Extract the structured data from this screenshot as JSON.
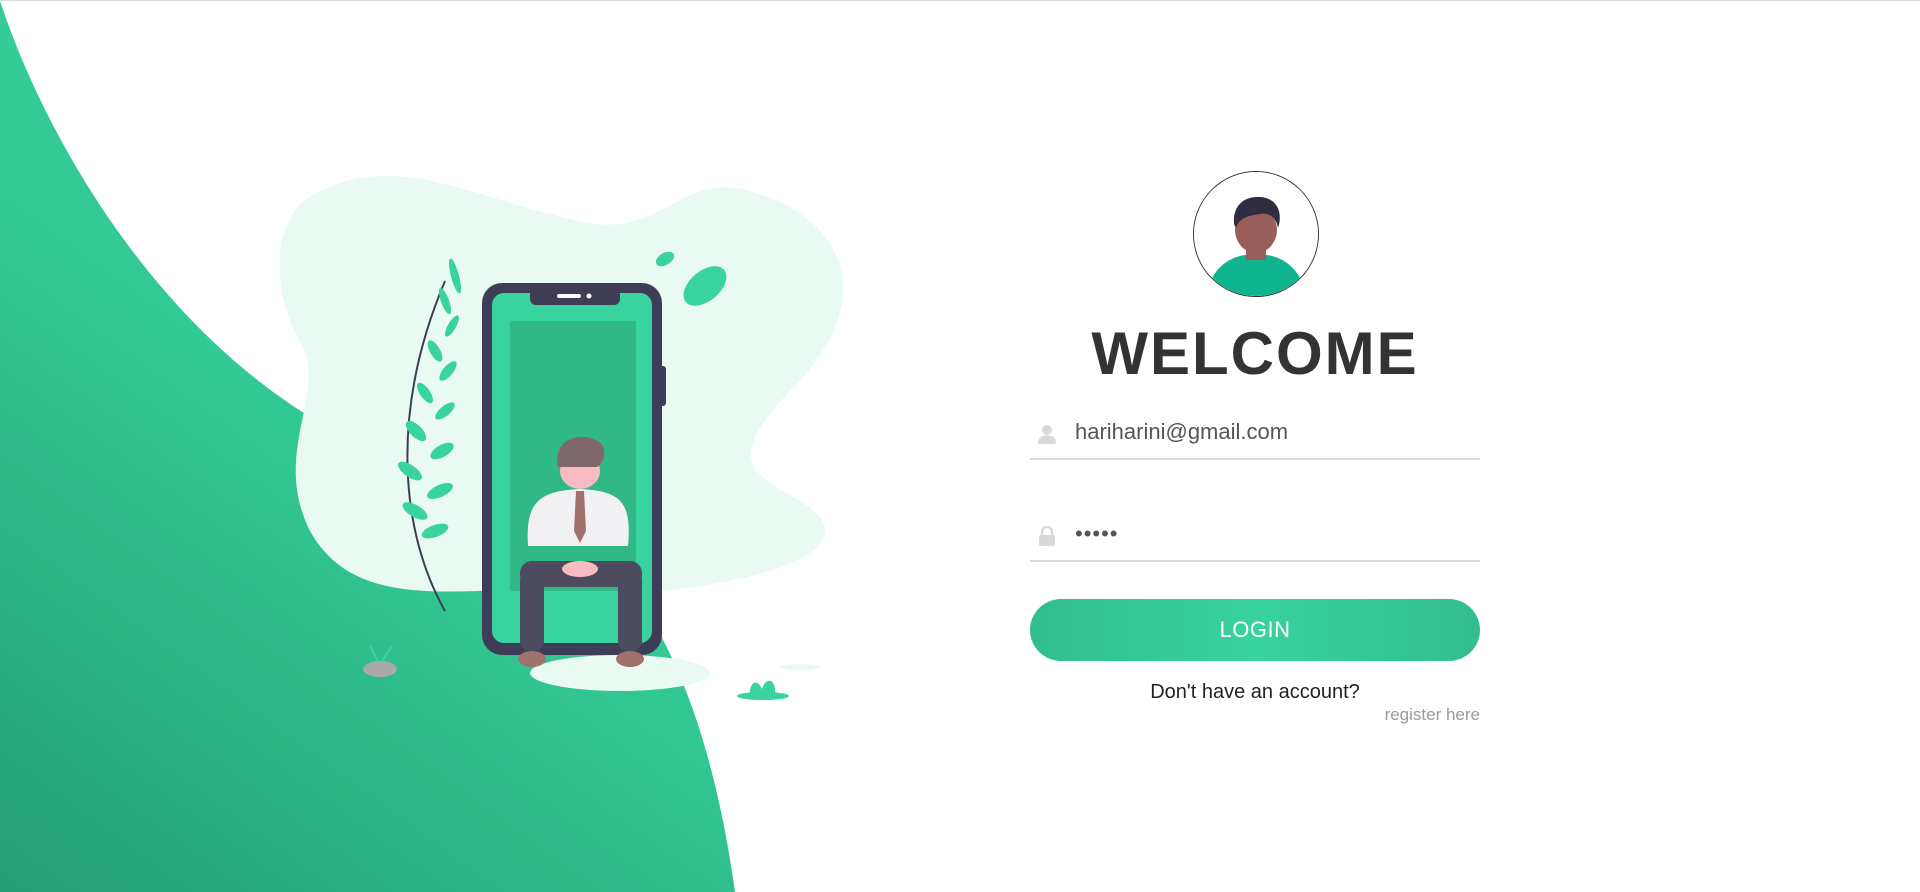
{
  "login": {
    "title": "WELCOME",
    "email": {
      "value": "hariharini@gmail.com",
      "icon": "user-icon"
    },
    "password": {
      "value": "*****",
      "icon": "lock-icon"
    },
    "button_label": "LOGIN",
    "no_account_text": "Don't have an account?",
    "register_link": "register here"
  },
  "colors": {
    "accent": "#38d39f",
    "accent_dark": "#32be8f",
    "heading": "#333333",
    "phone_frame": "#3f3d56"
  }
}
